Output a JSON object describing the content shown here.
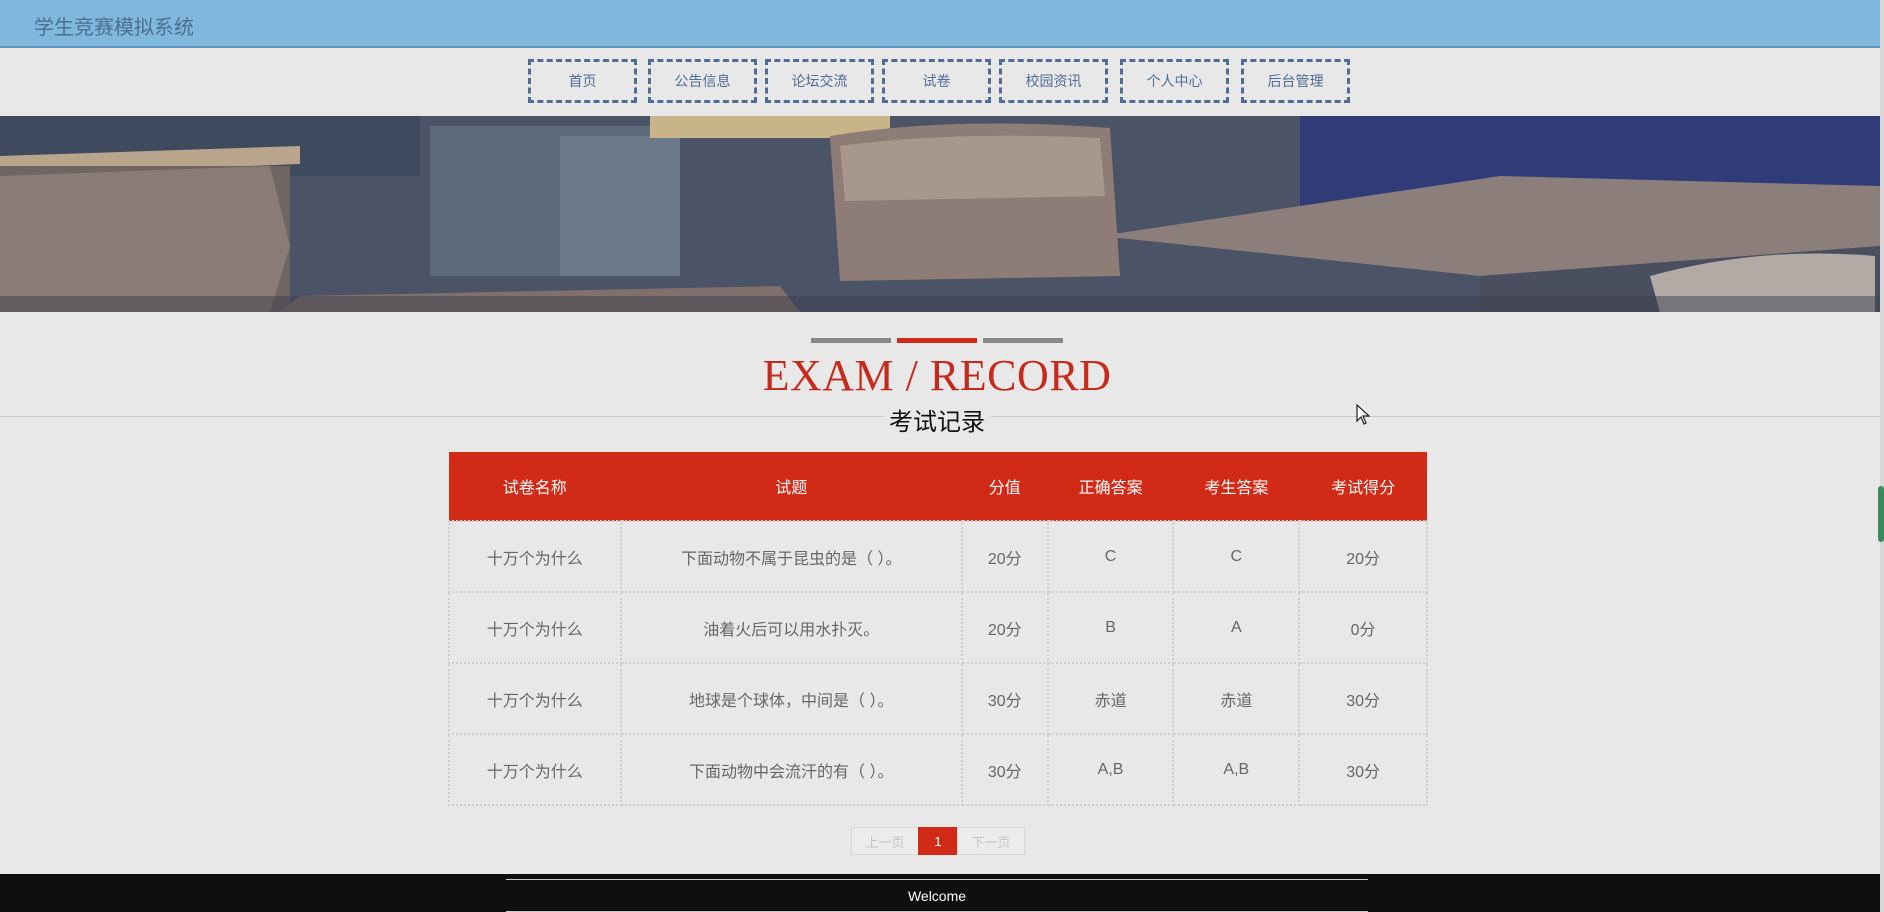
{
  "header": {
    "title": "学生竞赛模拟系统"
  },
  "nav": {
    "items": [
      "首页",
      "公告信息",
      "论坛交流",
      "试卷",
      "校园资讯",
      "个人中心",
      "后台管理"
    ]
  },
  "section": {
    "title": "EXAM / RECORD",
    "subtitle": "考试记录",
    "accent_color": "#c62a1c"
  },
  "table": {
    "columns": [
      "试卷名称",
      "试题",
      "分值",
      "正确答案",
      "考生答案",
      "考试得分"
    ],
    "rows": [
      [
        "十万个为什么",
        "下面动物不属于昆虫的是（ ）。",
        "20分",
        "C",
        "C",
        "20分"
      ],
      [
        "十万个为什么",
        "油着火后可以用水扑灭。",
        "20分",
        "B",
        "A",
        "0分"
      ],
      [
        "十万个为什么",
        "地球是个球体，中间是（ ）。",
        "30分",
        "赤道",
        "赤道",
        "30分"
      ],
      [
        "十万个为什么",
        "下面动物中会流汗的有（ ）。",
        "30分",
        "A,B",
        "A,B",
        "30分"
      ]
    ]
  },
  "pagination": {
    "prev": "上一页",
    "current": "1",
    "next": "下一页"
  },
  "footer": {
    "text": "Welcome"
  }
}
